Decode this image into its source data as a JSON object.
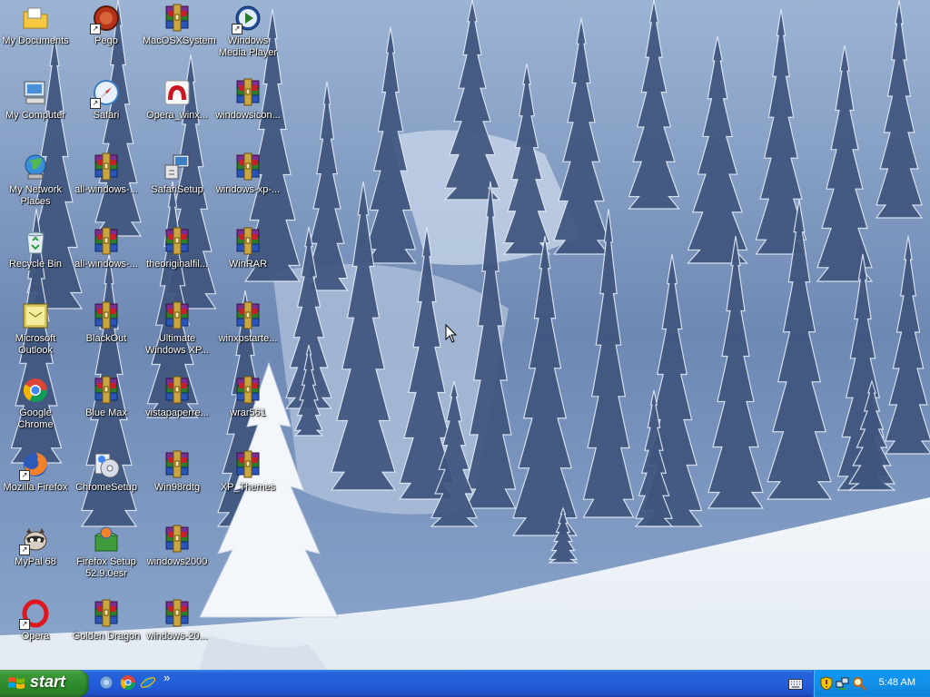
{
  "desktop": {
    "icons": [
      {
        "label": "My Documents"
      },
      {
        "label": "My Computer"
      },
      {
        "label": "My Network Places"
      },
      {
        "label": "Recycle Bin"
      },
      {
        "label": "Microsoft Outlook"
      },
      {
        "label": "Google Chrome"
      },
      {
        "label": "Mozilla Firefox"
      },
      {
        "label": "MyPal 68"
      },
      {
        "label": "Opera"
      },
      {
        "label": "Pego"
      },
      {
        "label": "Safari"
      },
      {
        "label": "all-windows-..."
      },
      {
        "label": "all-windows-..."
      },
      {
        "label": "BlackOut"
      },
      {
        "label": "Blue Max"
      },
      {
        "label": "ChromeSetup"
      },
      {
        "label": "Firefox Setup 52.9.0esr"
      },
      {
        "label": "Golden Dragon"
      },
      {
        "label": "MacOSXSystem"
      },
      {
        "label": "Opera_winx..."
      },
      {
        "label": "SafariSetup"
      },
      {
        "label": "theoriginalfil..."
      },
      {
        "label": "Ultimate Windows XP..."
      },
      {
        "label": "vistapaperre..."
      },
      {
        "label": "Win98rdtg"
      },
      {
        "label": "windows2000"
      },
      {
        "label": "windows-20..."
      },
      {
        "label": "Windows Media Player"
      },
      {
        "label": "windowsicon..."
      },
      {
        "label": "windows-xp-..."
      },
      {
        "label": "WinRAR"
      },
      {
        "label": "winxpstarte..."
      },
      {
        "label": "wrar561"
      },
      {
        "label": "XP_Themes"
      }
    ]
  },
  "taskbar": {
    "start_label": "start",
    "quick_launch": [
      {
        "icon": "internet-explorer-icon"
      },
      {
        "icon": "chrome-icon"
      },
      {
        "icon": "ie-e-icon"
      }
    ],
    "chevron": "»",
    "tray": {
      "clock": "5:48 AM",
      "icons": [
        "keyboard-icon",
        "security-shield-icon",
        "network-icon",
        "search-icon"
      ]
    }
  },
  "colors": {
    "taskbar_blue": "#245edb",
    "start_green": "#3c9a3b",
    "tray_blue": "#1290e8",
    "sky": "#c9dcf0"
  }
}
